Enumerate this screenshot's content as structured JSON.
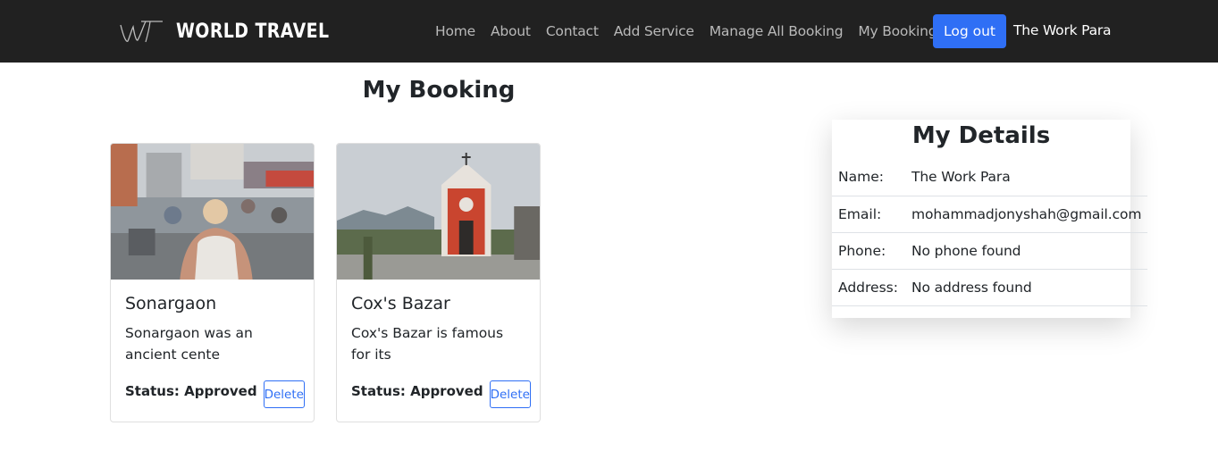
{
  "brand": {
    "logo_text": "WORLD TRAVEL",
    "logo_icon": "wt-script-monogram"
  },
  "nav": {
    "links": [
      "Home",
      "About",
      "Contact",
      "Add Service",
      "Manage All Booking",
      "My Booking"
    ],
    "logout_label": "Log out",
    "user_name": "The Work Para"
  },
  "page": {
    "title": "My Booking"
  },
  "bookings": [
    {
      "title": "Sonargaon",
      "description": "Sonargaon was an ancient cente",
      "status": "Status: Approved",
      "delete_label": "Delete",
      "image": "street-scene-photo"
    },
    {
      "title": "Cox's Bazar",
      "description": "Cox's Bazar is famous for its",
      "status": "Status: Approved",
      "delete_label": "Delete",
      "image": "red-church-photo"
    }
  ],
  "details": {
    "title": "My Details",
    "rows": [
      {
        "label": "Name:",
        "value": "The Work Para"
      },
      {
        "label": "Email:",
        "value": "mohammadjonyshah@gmail.com"
      },
      {
        "label": "Phone:",
        "value": "No phone found"
      },
      {
        "label": "Address:",
        "value": "No address found"
      }
    ]
  },
  "colors": {
    "navbar_bg": "#212121",
    "accent": "#2f6ff5",
    "nav_link": "#b9b9b9"
  }
}
